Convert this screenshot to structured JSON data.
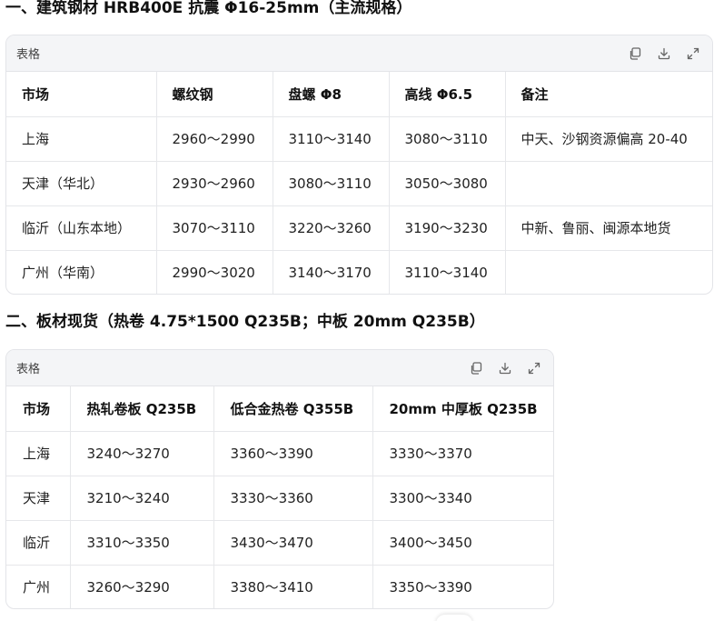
{
  "section1": {
    "heading": "一、建筑钢材 HRB400E 抗震 Φ16-25mm（主流规格）",
    "card_title": "表格",
    "columns": [
      "市场",
      "螺纹钢",
      "盘螺 Φ8",
      "高线 Φ6.5",
      "备注"
    ],
    "rows": [
      [
        "上海",
        "2960～2990",
        "3110～3140",
        "3080～3110",
        "中天、沙钢资源偏高 20-40"
      ],
      [
        "天津（华北）",
        "2930～2960",
        "3080～3110",
        "3050～3080",
        ""
      ],
      [
        "临沂（山东本地）",
        "3070～3110",
        "3220～3260",
        "3190～3230",
        "中新、鲁丽、闽源本地货"
      ],
      [
        "广州（华南）",
        "2990～3020",
        "3140～3170",
        "3110～3140",
        ""
      ]
    ]
  },
  "section2": {
    "heading": "二、板材现货（热卷 4.75*1500 Q235B；中板 20mm Q235B）",
    "card_title": "表格",
    "columns": [
      "市场",
      "热轧卷板 Q235B",
      "低合金热卷 Q355B",
      "20mm 中厚板 Q235B"
    ],
    "rows": [
      [
        "上海",
        "3240～3270",
        "3360～3390",
        "3330～3370"
      ],
      [
        "天津",
        "3210～3240",
        "3330～3360",
        "3300～3340"
      ],
      [
        "临沂",
        "3310～3350",
        "3430～3470",
        "3400～3450"
      ],
      [
        "广州",
        "3260～3290",
        "3380～3410",
        "3350～3390"
      ]
    ]
  },
  "toolbar_icons": [
    "copy-icon",
    "download-icon",
    "expand-icon"
  ]
}
